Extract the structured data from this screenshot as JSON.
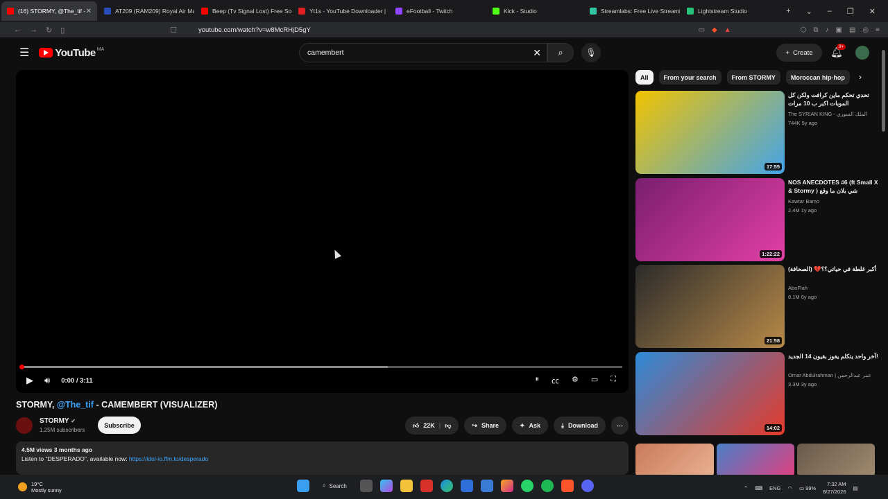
{
  "browser": {
    "tabs": [
      {
        "title": "(16) STORMY, @The_tif -",
        "color": "#ff0000",
        "active": true
      },
      {
        "title": "AT209 (RAM209) Royal Air Ma",
        "color": "#2a4dbb",
        "active": false
      },
      {
        "title": "Beep (Tv Signal Lost) Free Sou",
        "color": "#ff0000",
        "active": false
      },
      {
        "title": "Yt1s - YouTube Downloader |",
        "color": "#e02020",
        "active": false
      },
      {
        "title": "eFootball - Twitch",
        "color": "#9146ff",
        "active": false
      },
      {
        "title": "Kick - Studio",
        "color": "#53fc18",
        "active": false
      },
      {
        "title": "Streamlabs: Free Live Streami",
        "color": "#31c3a2",
        "active": false
      },
      {
        "title": "Lightstream Studio",
        "color": "#28c07a",
        "active": false
      }
    ],
    "new_tab_icon": "+",
    "url": "youtube.com/watch?v=w8McRHjD5gY"
  },
  "youtube": {
    "logo_text": "YouTube",
    "country_code": "MA",
    "search_value": "camembert",
    "create_label": "Create",
    "notif_badge": "9+"
  },
  "player": {
    "time": "0:00 / 3:11",
    "progress_fraction": 0.0,
    "buffered_fraction": 0.61
  },
  "video": {
    "title_prefix": "STORMY, ",
    "title_link": "@The_tif",
    "title_suffix": " - CAMEMBERT (VISUALIZER)",
    "channel": "STORMY",
    "subscribers": "1.25M subscribers",
    "subscribe_label": "Subscribe",
    "likes": "22K",
    "share_label": "Share",
    "ask_label": "Ask",
    "download_label": "Download",
    "stats": "4.5M views  3 months ago",
    "desc_text": "Listen to \"DESPERADO\", available now: ",
    "desc_link": "https://idol-io.ffm.to/desperado"
  },
  "chips": [
    "All",
    "From your search",
    "From STORMY",
    "Moroccan hip-hop"
  ],
  "recommendations": [
    {
      "title": "تحدي تحكم ماين كرافت ولكن كل الموبات اكبر ب 10 مرات",
      "channel": "The SYRIAN KING - الملك السوري",
      "meta": "744K  5y ago",
      "duration": "17:55",
      "thumb_a": "#f2c300",
      "thumb_b": "#43a4e8"
    },
    {
      "title": "NOS ANECDOTES #6 (ft Small X & Stormy ) شي بلان ما وقع",
      "channel": "Kawtar Bamo",
      "meta": "2.4M  1y ago",
      "duration": "1:22:22",
      "thumb_a": "#7a1e6f",
      "thumb_b": "#e23fa6"
    },
    {
      "title": "أكبر غلطة في حياتي؟؟💔 (الصحافة)",
      "channel": "AboFlah",
      "meta": "8.1M  6y ago",
      "duration": "21:58",
      "thumb_a": "#2b2b2b",
      "thumb_b": "#b88a48"
    },
    {
      "title": "آخر واحد يتكلم يفوز بقيون 14 الجديد!",
      "channel": "Omar Abdulrahman | عمر عبدالرحمن",
      "meta": "3.3M  3y ago",
      "duration": "14:02",
      "thumb_a": "#2d8ad8",
      "thumb_b": "#e63a2a"
    }
  ],
  "taskbar": {
    "temperature": "19°C",
    "weather": "Mostly sunny",
    "search_label": "Search",
    "lang": "ENG",
    "battery": "99%",
    "time": "7:32 AM",
    "date": "8/27/2026"
  }
}
